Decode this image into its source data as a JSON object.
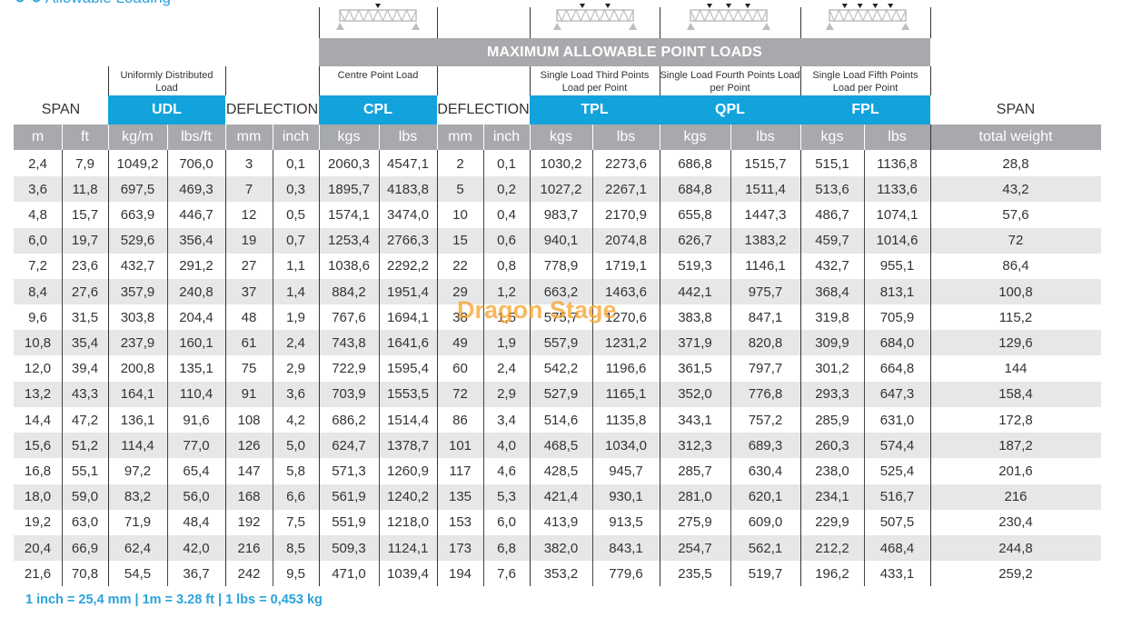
{
  "header": {
    "title": "Allowable Loading",
    "max_point_loads_label": "MAXIMUM ALLOWABLE POINT LOADS",
    "span_left_label": "SPAN",
    "span_right_label": "SPAN",
    "deflection_label_1": "DEFLECTION",
    "deflection_label_2": "DEFLECTION",
    "load_types": [
      {
        "code": "UDL",
        "description": "Uniformly Distributed Load",
        "load_points": 0
      },
      {
        "code": "CPL",
        "description": "Centre Point Load",
        "load_points": 1
      },
      {
        "code": "TPL",
        "description": "Single Load Third Points Load per Point",
        "load_points": 2
      },
      {
        "code": "QPL",
        "description": "Single Load Fourth Points Load per Point",
        "load_points": 3
      },
      {
        "code": "FPL",
        "description": "Single Load Fifth Points Load per Point",
        "load_points": 4
      }
    ],
    "units": [
      "m",
      "ft",
      "kg/m",
      "lbs/ft",
      "mm",
      "inch",
      "kgs",
      "lbs",
      "mm",
      "inch",
      "kgs",
      "lbs",
      "kgs",
      "lbs",
      "kgs",
      "lbs",
      "total weight"
    ]
  },
  "colors": {
    "accent_blue": "#12a3dc",
    "header_gray": "#a7a9ac",
    "stripe_gray": "#e6e7e8",
    "footnote_blue": "#29a3dc"
  },
  "rows": [
    [
      "2,4",
      "7,9",
      "1049,2",
      "706,0",
      "3",
      "0,1",
      "2060,3",
      "4547,1",
      "2",
      "0,1",
      "1030,2",
      "2273,6",
      "686,8",
      "1515,7",
      "515,1",
      "1136,8",
      "28,8"
    ],
    [
      "3,6",
      "11,8",
      "697,5",
      "469,3",
      "7",
      "0,3",
      "1895,7",
      "4183,8",
      "5",
      "0,2",
      "1027,2",
      "2267,1",
      "684,8",
      "1511,4",
      "513,6",
      "1133,6",
      "43,2"
    ],
    [
      "4,8",
      "15,7",
      "663,9",
      "446,7",
      "12",
      "0,5",
      "1574,1",
      "3474,0",
      "10",
      "0,4",
      "983,7",
      "2170,9",
      "655,8",
      "1447,3",
      "486,7",
      "1074,1",
      "57,6"
    ],
    [
      "6,0",
      "19,7",
      "529,6",
      "356,4",
      "19",
      "0,7",
      "1253,4",
      "2766,3",
      "15",
      "0,6",
      "940,1",
      "2074,8",
      "626,7",
      "1383,2",
      "459,7",
      "1014,6",
      "72"
    ],
    [
      "7,2",
      "23,6",
      "432,7",
      "291,2",
      "27",
      "1,1",
      "1038,6",
      "2292,2",
      "22",
      "0,8",
      "778,9",
      "1719,1",
      "519,3",
      "1146,1",
      "432,7",
      "955,1",
      "86,4"
    ],
    [
      "8,4",
      "27,6",
      "357,9",
      "240,8",
      "37",
      "1,4",
      "884,2",
      "1951,4",
      "29",
      "1,2",
      "663,2",
      "1463,6",
      "442,1",
      "975,7",
      "368,4",
      "813,1",
      "100,8"
    ],
    [
      "9,6",
      "31,5",
      "303,8",
      "204,4",
      "48",
      "1,9",
      "767,6",
      "1694,1",
      "38",
      "1,5",
      "575,7",
      "1270,6",
      "383,8",
      "847,1",
      "319,8",
      "705,9",
      "115,2"
    ],
    [
      "10,8",
      "35,4",
      "237,9",
      "160,1",
      "61",
      "2,4",
      "743,8",
      "1641,6",
      "49",
      "1,9",
      "557,9",
      "1231,2",
      "371,9",
      "820,8",
      "309,9",
      "684,0",
      "129,6"
    ],
    [
      "12,0",
      "39,4",
      "200,8",
      "135,1",
      "75",
      "2,9",
      "722,9",
      "1595,4",
      "60",
      "2,4",
      "542,2",
      "1196,6",
      "361,5",
      "797,7",
      "301,2",
      "664,8",
      "144"
    ],
    [
      "13,2",
      "43,3",
      "164,1",
      "110,4",
      "91",
      "3,6",
      "703,9",
      "1553,5",
      "72",
      "2,9",
      "527,9",
      "1165,1",
      "352,0",
      "776,8",
      "293,3",
      "647,3",
      "158,4"
    ],
    [
      "14,4",
      "47,2",
      "136,1",
      "91,6",
      "108",
      "4,2",
      "686,2",
      "1514,4",
      "86",
      "3,4",
      "514,6",
      "1135,8",
      "343,1",
      "757,2",
      "285,9",
      "631,0",
      "172,8"
    ],
    [
      "15,6",
      "51,2",
      "114,4",
      "77,0",
      "126",
      "5,0",
      "624,7",
      "1378,7",
      "101",
      "4,0",
      "468,5",
      "1034,0",
      "312,3",
      "689,3",
      "260,3",
      "574,4",
      "187,2"
    ],
    [
      "16,8",
      "55,1",
      "97,2",
      "65,4",
      "147",
      "5,8",
      "571,3",
      "1260,9",
      "117",
      "4,6",
      "428,5",
      "945,7",
      "285,7",
      "630,4",
      "238,0",
      "525,4",
      "201,6"
    ],
    [
      "18,0",
      "59,0",
      "83,2",
      "56,0",
      "168",
      "6,6",
      "561,9",
      "1240,2",
      "135",
      "5,3",
      "421,4",
      "930,1",
      "281,0",
      "620,1",
      "234,1",
      "516,7",
      "216"
    ],
    [
      "19,2",
      "63,0",
      "71,9",
      "48,4",
      "192",
      "7,5",
      "551,9",
      "1218,0",
      "153",
      "6,0",
      "413,9",
      "913,5",
      "275,9",
      "609,0",
      "229,9",
      "507,5",
      "230,4"
    ],
    [
      "20,4",
      "66,9",
      "62,4",
      "42,0",
      "216",
      "8,5",
      "509,3",
      "1124,1",
      "173",
      "6,8",
      "382,0",
      "843,1",
      "254,7",
      "562,1",
      "212,2",
      "468,4",
      "244,8"
    ],
    [
      "21,6",
      "70,8",
      "54,5",
      "36,7",
      "242",
      "9,5",
      "471,0",
      "1039,4",
      "194",
      "7,6",
      "353,2",
      "779,6",
      "235,5",
      "519,7",
      "196,2",
      "433,1",
      "259,2"
    ]
  ],
  "footnote": "1 inch = 25,4 mm  |  1m = 3.28 ft  |  1 lbs = 0,453 kg",
  "watermark": "Dragon Stage"
}
